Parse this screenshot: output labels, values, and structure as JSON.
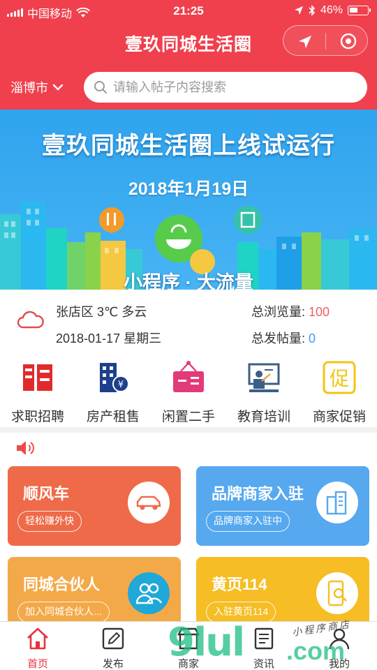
{
  "status_bar": {
    "carrier": "中国移动",
    "time": "21:25",
    "battery": "46%",
    "battery_level": 0.46
  },
  "header": {
    "title": "壹玖同城生活圈",
    "city": "淄博市",
    "search_placeholder": "请输入帖子内容搜索"
  },
  "banner": {
    "title": "壹玖同城生活圈上线试运行",
    "date": "2018年1月19日",
    "slogan": "小程序 · 大流量"
  },
  "info": {
    "location_weather": "张店区 3℃ 多云",
    "date_weekday": "2018-01-17 星期三",
    "views_label": "总浏览量:",
    "views_value": "100",
    "posts_label": "总发帖量:",
    "posts_value": "0"
  },
  "categories": [
    {
      "label": "求职招聘",
      "icon": "recruit-icon"
    },
    {
      "label": "房产租售",
      "icon": "building-icon"
    },
    {
      "label": "闲置二手",
      "icon": "secondhand-icon"
    },
    {
      "label": "教育培训",
      "icon": "teaching-icon"
    },
    {
      "label": "商家促销",
      "icon": "promotion-icon"
    }
  ],
  "cards": [
    {
      "title": "顺风车",
      "button": "轻松赚外快",
      "icon": "car-icon",
      "color": "#ef6a49"
    },
    {
      "title": "品牌商家入驻",
      "button": "品牌商家入驻中",
      "icon": "buildings-icon",
      "color": "#56a8ef"
    },
    {
      "title": "同城合伙人",
      "button": "加入同城合伙人...",
      "icon": "partners-icon",
      "color": "#f4a948"
    },
    {
      "title": "黄页114",
      "button": "入驻黄页114",
      "icon": "phone-search-icon",
      "color": "#f6bd24"
    }
  ],
  "tabs": [
    {
      "label": "首页",
      "icon": "home-icon",
      "active": true
    },
    {
      "label": "发布",
      "icon": "edit-icon",
      "active": false
    },
    {
      "label": "商家",
      "icon": "shop-icon",
      "active": false
    },
    {
      "label": "资讯",
      "icon": "news-icon",
      "active": false
    },
    {
      "label": "我的",
      "icon": "user-icon",
      "active": false
    }
  ],
  "watermark": {
    "big": "9lul",
    "com": ".com",
    "small": "小程序商店"
  },
  "colors": {
    "header_red": "#f0404d",
    "active_tab": "#e8323e",
    "views_value": "#f06060",
    "posts_value": "#3a9cf0"
  }
}
